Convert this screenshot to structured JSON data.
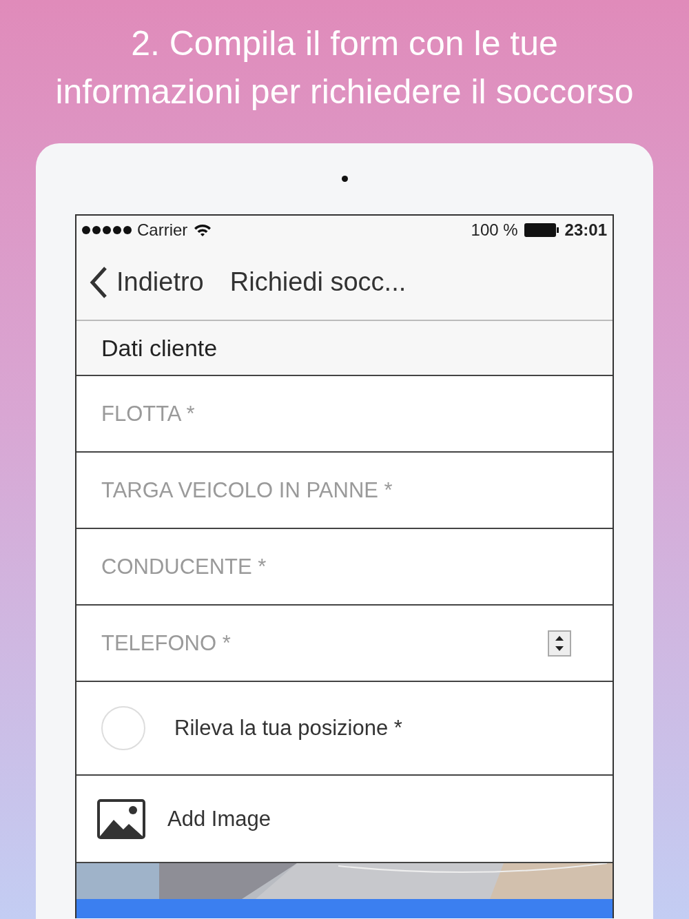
{
  "caption": [
    "2. Compila il form con le tue",
    "informazioni per richiedere il soccorso"
  ],
  "status_bar": {
    "carrier": "Carrier",
    "battery": "100 %",
    "time": "23:01"
  },
  "nav_bar": {
    "back": "Indietro",
    "title": "Richiedi socc..."
  },
  "section": {
    "title": "Dati cliente"
  },
  "fields": [
    {
      "placeholder": "FLOTTA *",
      "kind": "text"
    },
    {
      "placeholder": "TARGA VEICOLO IN PANNE *",
      "kind": "text"
    },
    {
      "placeholder": "CONDUCENTE *",
      "kind": "text"
    },
    {
      "placeholder": "TELEFONO *",
      "kind": "number"
    }
  ],
  "location": {
    "label": "Rileva la tua posizione *",
    "checked": false
  },
  "add_image": {
    "label": "Add Image"
  }
}
